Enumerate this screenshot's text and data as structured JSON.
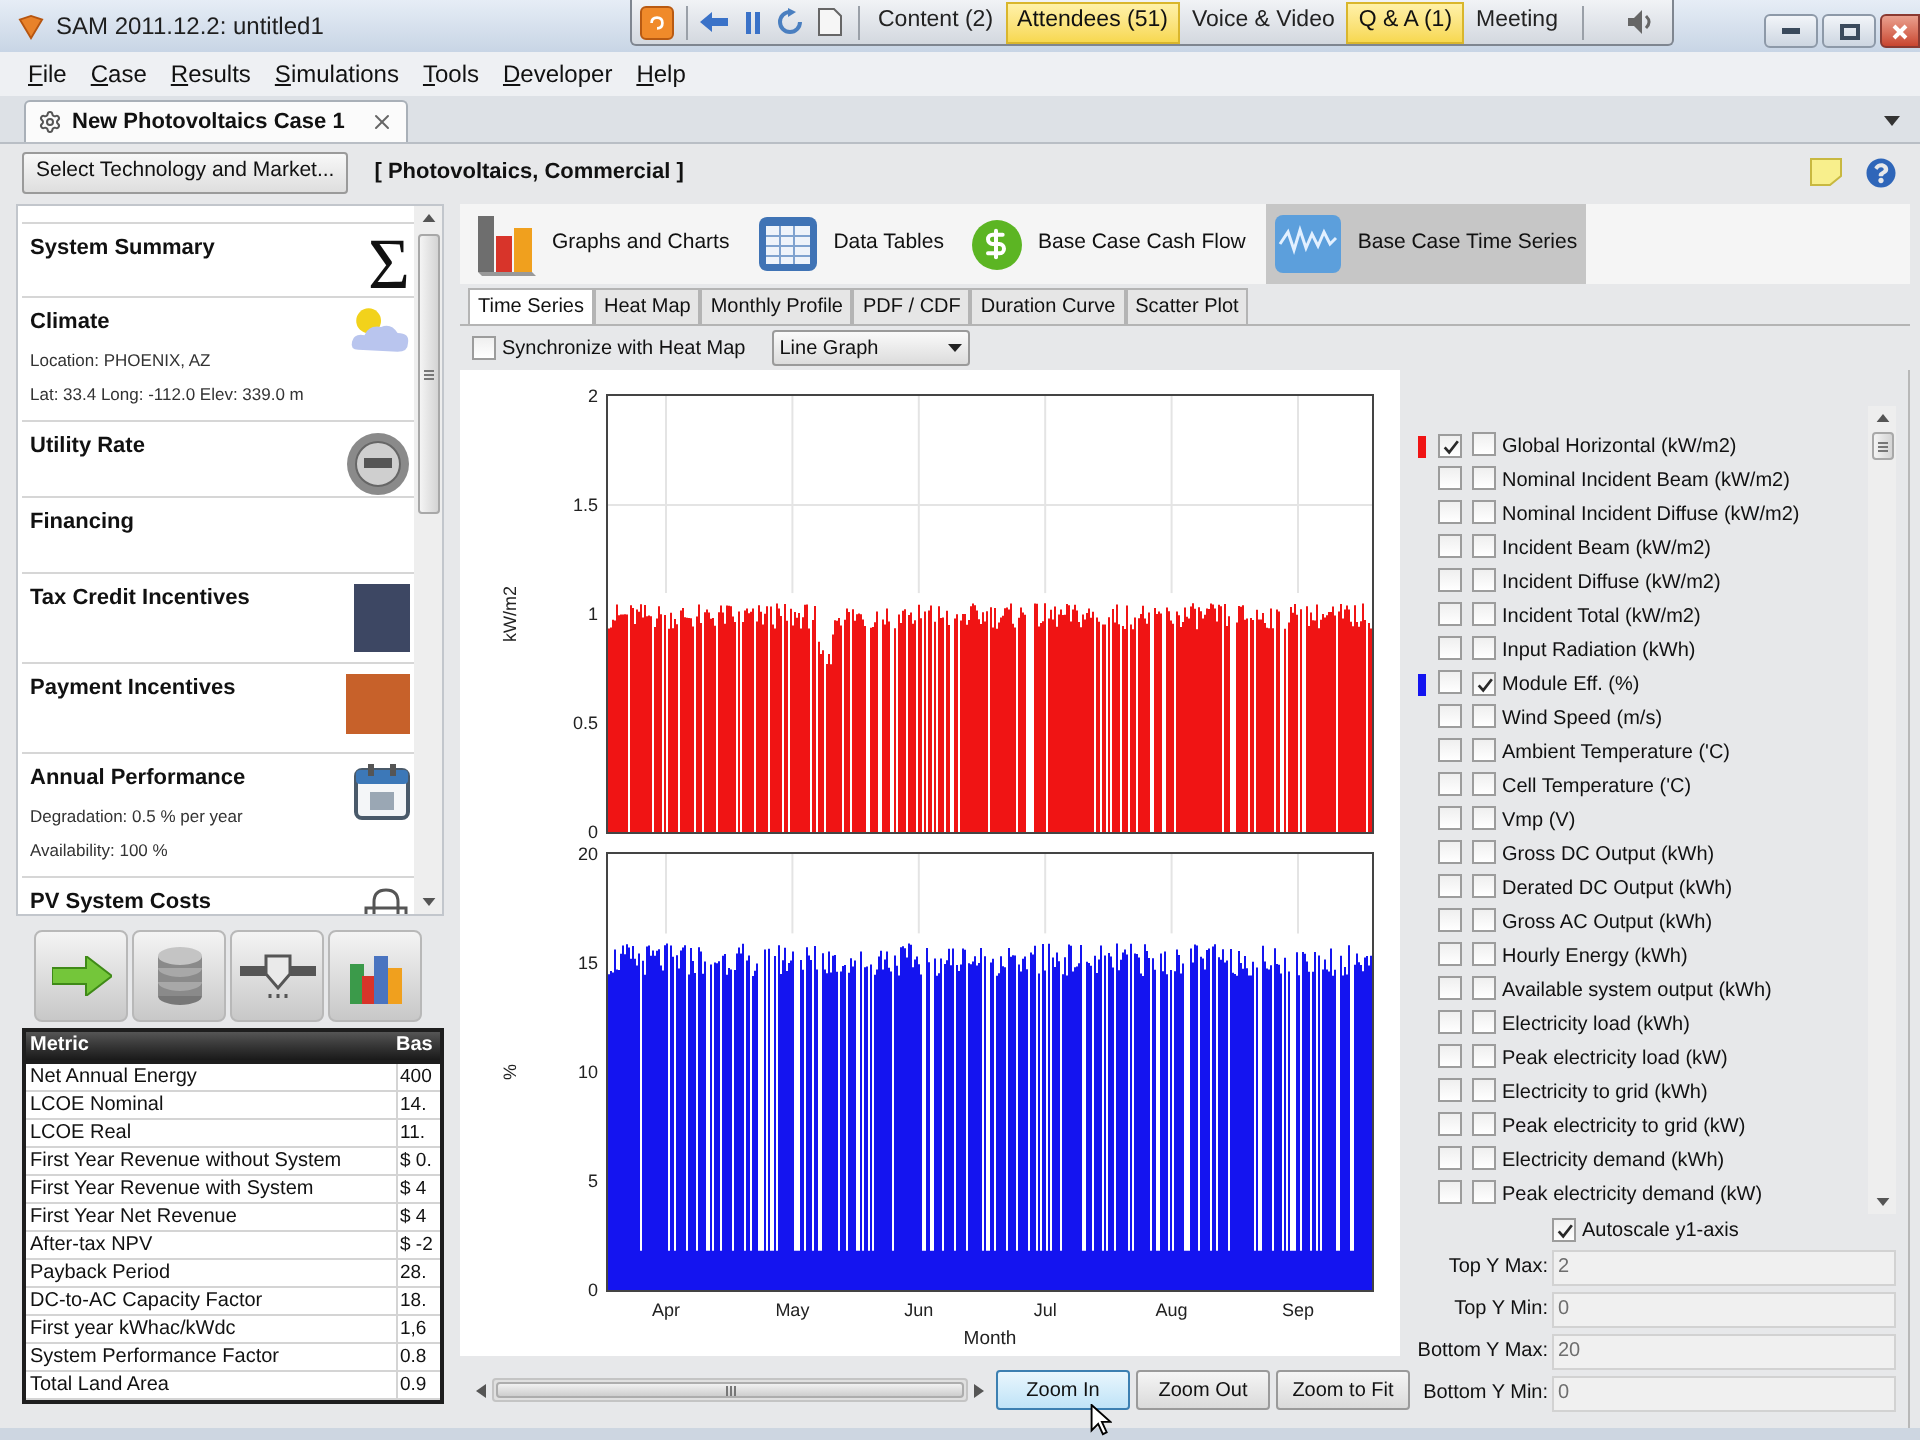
{
  "window": {
    "title": "SAM 2011.12.2: untitled1"
  },
  "meeting_toolbar": {
    "buttons": [
      {
        "label": "Content (2)",
        "highlighted": false
      },
      {
        "label": "Attendees (51)",
        "highlighted": true
      },
      {
        "label": "Voice & Video",
        "highlighted": false
      },
      {
        "label": "Q & A (1)",
        "highlighted": true
      },
      {
        "label": "Meeting",
        "highlighted": false
      }
    ]
  },
  "menu": [
    "File",
    "Case",
    "Results",
    "Simulations",
    "Tools",
    "Developer",
    "Help"
  ],
  "case_tabs": [
    {
      "label": "New Photovoltaics Case 1",
      "selected": true
    }
  ],
  "toolbar": {
    "button": "Select Technology and Market...",
    "technology": "[ Photovoltaics, Commercial ]"
  },
  "sidebar": {
    "items": [
      {
        "title": "System Summary",
        "symbol": "Σ"
      },
      {
        "title": "Climate",
        "details": [
          "Location: PHOENIX, AZ",
          "Lat: 33.4 Long: -112.0 Elev: 339.0 m"
        ]
      },
      {
        "title": "Utility Rate"
      },
      {
        "title": "Financing"
      },
      {
        "title": "Tax Credit Incentives"
      },
      {
        "title": "Payment Incentives"
      },
      {
        "title": "Annual Performance",
        "details": [
          "Degradation: 0.5 % per year",
          "Availability: 100 %"
        ]
      },
      {
        "title": "PV System Costs"
      }
    ]
  },
  "metrics": {
    "columns": [
      "Metric",
      "Bas"
    ],
    "rows": [
      [
        "Net Annual Energy",
        "400"
      ],
      [
        "LCOE Nominal",
        "14."
      ],
      [
        "LCOE Real",
        "11."
      ],
      [
        "First Year Revenue without System",
        "$ 0."
      ],
      [
        "First Year Revenue with System",
        "$ 4"
      ],
      [
        "First Year Net Revenue",
        "$ 4"
      ],
      [
        "After-tax NPV",
        "$ -2"
      ],
      [
        "Payback Period",
        "28."
      ],
      [
        "DC-to-AC Capacity Factor",
        "18."
      ],
      [
        "First year kWhac/kWdc",
        "1,6"
      ],
      [
        "System Performance Factor",
        "0.8"
      ],
      [
        "Total Land Area",
        "0.9"
      ]
    ]
  },
  "views": [
    {
      "label": "Graphs and Charts",
      "selected": false
    },
    {
      "label": "Data Tables",
      "selected": false
    },
    {
      "label": "Base Case Cash Flow",
      "selected": false
    },
    {
      "label": "Base Case Time Series",
      "selected": true
    }
  ],
  "chart_tabs": [
    {
      "label": "Time Series",
      "selected": true
    },
    {
      "label": "Heat Map",
      "selected": false
    },
    {
      "label": "Monthly Profile",
      "selected": false
    },
    {
      "label": "PDF / CDF",
      "selected": false
    },
    {
      "label": "Duration Curve",
      "selected": false
    },
    {
      "label": "Scatter Plot",
      "selected": false
    }
  ],
  "sync": {
    "label": "Synchronize with Heat Map",
    "checked": false
  },
  "graph_type": {
    "value": "Line Graph"
  },
  "top_plot": {
    "y_label": "kW/m2",
    "y_ticks": [
      "2",
      "1.5",
      "1",
      "0.5",
      "0"
    ]
  },
  "bottom_plot": {
    "y_label": "%",
    "y_ticks": [
      "20",
      "15",
      "10",
      "5",
      "0"
    ],
    "x_ticks": [
      "Apr",
      "May",
      "Jun",
      "Jul",
      "Aug",
      "Sep"
    ],
    "x_label": "Month"
  },
  "variables": [
    {
      "label": "Global Horizontal (kW/m2)",
      "top": true,
      "bottom": false,
      "color": "#f01414"
    },
    {
      "label": "Nominal Incident Beam (kW/m2)",
      "top": false,
      "bottom": false
    },
    {
      "label": "Nominal Incident Diffuse (kW/m2)",
      "top": false,
      "bottom": false
    },
    {
      "label": "Incident Beam (kW/m2)",
      "top": false,
      "bottom": false
    },
    {
      "label": "Incident Diffuse (kW/m2)",
      "top": false,
      "bottom": false
    },
    {
      "label": "Incident Total (kW/m2)",
      "top": false,
      "bottom": false
    },
    {
      "label": "Input Radiation (kWh)",
      "top": false,
      "bottom": false
    },
    {
      "label": "Module Eff. (%)",
      "top": false,
      "bottom": true,
      "color": "#1414f0"
    },
    {
      "label": "Wind Speed (m/s)",
      "top": false,
      "bottom": false
    },
    {
      "label": "Ambient Temperature ('C)",
      "top": false,
      "bottom": false
    },
    {
      "label": "Cell Temperature ('C)",
      "top": false,
      "bottom": false
    },
    {
      "label": "Vmp (V)",
      "top": false,
      "bottom": false
    },
    {
      "label": "Gross DC Output (kWh)",
      "top": false,
      "bottom": false
    },
    {
      "label": "Derated DC Output (kWh)",
      "top": false,
      "bottom": false
    },
    {
      "label": "Gross AC Output (kWh)",
      "top": false,
      "bottom": false
    },
    {
      "label": "Hourly Energy (kWh)",
      "top": false,
      "bottom": false
    },
    {
      "label": "Available system output (kWh)",
      "top": false,
      "bottom": false
    },
    {
      "label": "Electricity load (kWh)",
      "top": false,
      "bottom": false
    },
    {
      "label": "Peak electricity load (kW)",
      "top": false,
      "bottom": false
    },
    {
      "label": "Electricity to grid (kWh)",
      "top": false,
      "bottom": false
    },
    {
      "label": "Peak electricity to grid (kW)",
      "top": false,
      "bottom": false
    },
    {
      "label": "Electricity demand (kWh)",
      "top": false,
      "bottom": false
    },
    {
      "label": "Peak electricity demand (kW)",
      "top": false,
      "bottom": false
    }
  ],
  "autoscale": {
    "label": "Autoscale y1-axis",
    "checked": true
  },
  "axis_fields": [
    {
      "label": "Top Y Max:",
      "value": "2",
      "disabled": true
    },
    {
      "label": "Top Y Min:",
      "value": "0",
      "disabled": true
    },
    {
      "label": "Bottom Y Max:",
      "value": "20",
      "disabled": true
    },
    {
      "label": "Bottom Y Min:",
      "value": "0",
      "disabled": true
    }
  ],
  "zoom_buttons": [
    {
      "label": "Zoom In",
      "highlighted": true
    },
    {
      "label": "Zoom Out",
      "highlighted": false
    },
    {
      "label": "Zoom to Fit",
      "highlighted": false
    }
  ]
}
